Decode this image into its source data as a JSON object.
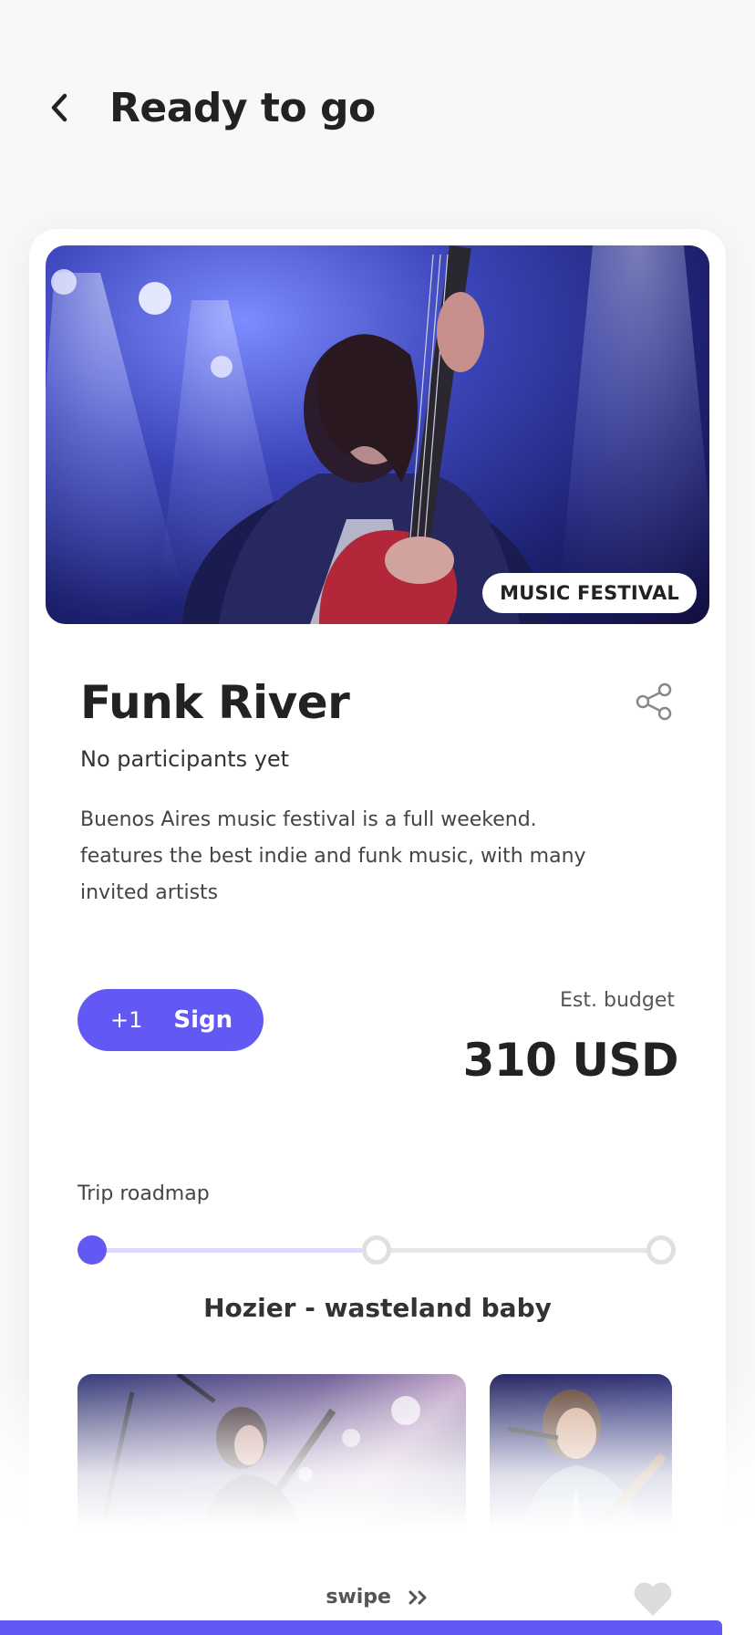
{
  "header": {
    "title": "Ready to go",
    "back_icon": "chevron-left-icon"
  },
  "event": {
    "category": "MUSIC FESTIVAL",
    "title": "Funk River",
    "participants": "No participants yet",
    "description": "Buenos Aires music festival is a full weekend. features the best indie and funk music, with many invited artists",
    "share_icon": "share-icon"
  },
  "sign": {
    "count": "+1",
    "label": "Sign"
  },
  "budget": {
    "label": "Est. budget",
    "value": "310 USD"
  },
  "roadmap": {
    "label": "Trip roadmap",
    "current_step": 1,
    "total_steps": 3,
    "song": "Hozier - wasteland baby"
  },
  "footer": {
    "swipe_label": "swipe",
    "swipe_icon": "double-chevron-right-icon",
    "heart_icon": "heart-icon"
  },
  "colors": {
    "accent": "#6259f5",
    "background": "#f8f8f9",
    "track_fill": "#dcdaf9"
  }
}
